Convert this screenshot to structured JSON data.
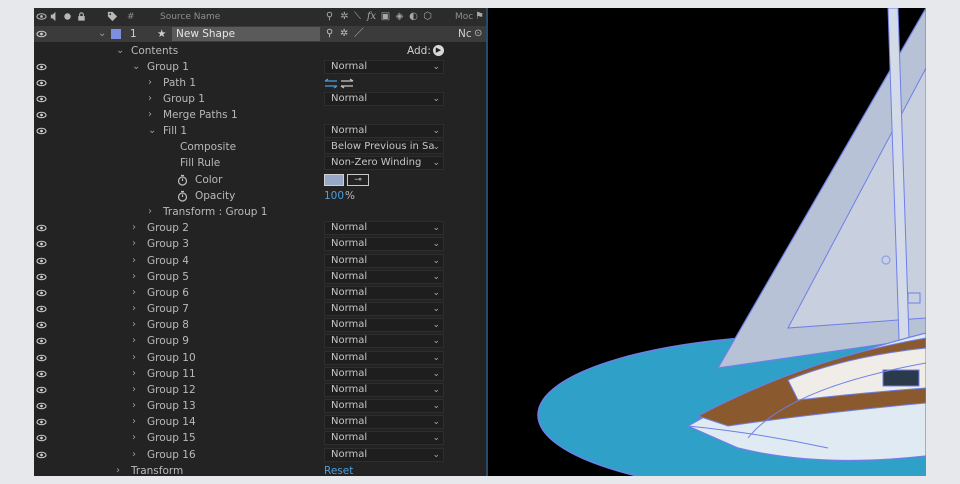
{
  "header": {
    "num_label": "#",
    "source_name_label": "Source Name",
    "mode_label": "Moc"
  },
  "layer": {
    "number": "1",
    "name": "New Shape",
    "mode_short": "Nc",
    "label_color": "#7f8fe0"
  },
  "contents": {
    "label": "Contents",
    "add_label": "Add:"
  },
  "group1": {
    "label": "Group 1",
    "mode": "Normal",
    "path": {
      "label": "Path 1"
    },
    "subgroup": {
      "label": "Group 1",
      "mode": "Normal"
    },
    "merge": {
      "label": "Merge Paths 1"
    },
    "fill": {
      "label": "Fill 1",
      "mode": "Normal",
      "composite_label": "Composite",
      "composite_value": "Below Previous in Sa",
      "fill_rule_label": "Fill Rule",
      "fill_rule_value": "Non-Zero Winding",
      "color_label": "Color",
      "color_swatch": "#9aa8c8",
      "opacity_label": "Opacity",
      "opacity_value": "100",
      "opacity_unit": "%"
    },
    "transform": {
      "label": "Transform : Group 1"
    }
  },
  "groups": [
    {
      "label": "Group 2",
      "mode": "Normal"
    },
    {
      "label": "Group 3",
      "mode": "Normal"
    },
    {
      "label": "Group 4",
      "mode": "Normal"
    },
    {
      "label": "Group 5",
      "mode": "Normal"
    },
    {
      "label": "Group 6",
      "mode": "Normal"
    },
    {
      "label": "Group 7",
      "mode": "Normal"
    },
    {
      "label": "Group 8",
      "mode": "Normal"
    },
    {
      "label": "Group 9",
      "mode": "Normal"
    },
    {
      "label": "Group 10",
      "mode": "Normal"
    },
    {
      "label": "Group 11",
      "mode": "Normal"
    },
    {
      "label": "Group 12",
      "mode": "Normal"
    },
    {
      "label": "Group 13",
      "mode": "Normal"
    },
    {
      "label": "Group 14",
      "mode": "Normal"
    },
    {
      "label": "Group 15",
      "mode": "Normal"
    },
    {
      "label": "Group 16",
      "mode": "Normal"
    }
  ],
  "transform": {
    "label": "Transform",
    "reset_label": "Reset"
  },
  "colors": {
    "accent_blue": "#4a9fe0",
    "panel_bg": "#232323",
    "water": "#2fa0c8",
    "deck": "#8a5a2e",
    "sail": "#c8d0e0"
  }
}
